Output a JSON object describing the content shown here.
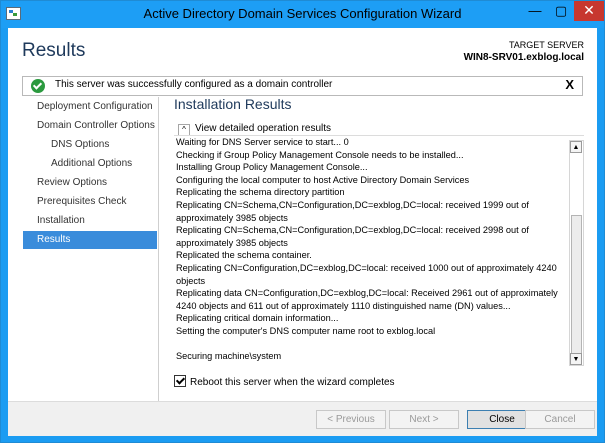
{
  "window": {
    "title": "Active Directory Domain Services Configuration Wizard",
    "minimize_glyph": "—",
    "maximize_glyph": "▢",
    "close_glyph": "✕",
    "accent": "#1d9ef5"
  },
  "header": {
    "title": "Results",
    "target_label": "TARGET SERVER",
    "target_value": "WIN8-SRV01.exblog.local"
  },
  "banner": {
    "message": "This server was successfully configured as a domain controller",
    "close_glyph": "X",
    "icon": "success-check-icon"
  },
  "nav": {
    "items": [
      {
        "label": "Deployment Configuration",
        "sub": false,
        "active": false
      },
      {
        "label": "Domain Controller Options",
        "sub": false,
        "active": false
      },
      {
        "label": "DNS Options",
        "sub": true,
        "active": false
      },
      {
        "label": "Additional Options",
        "sub": true,
        "active": false
      },
      {
        "label": "Review Options",
        "sub": false,
        "active": false
      },
      {
        "label": "Prerequisites Check",
        "sub": false,
        "active": false
      },
      {
        "label": "Installation",
        "sub": false,
        "active": false
      },
      {
        "label": "Results",
        "sub": false,
        "active": true
      }
    ]
  },
  "main": {
    "section_title": "Installation Results",
    "expand_label": "View detailed operation results",
    "expand_glyph": "^",
    "log": [
      "Waiting for DNS Server service to start... 0",
      "Checking if Group Policy Management Console needs to be installed...",
      "Installing Group Policy Management Console...",
      "Configuring the local computer to host Active Directory Domain Services",
      "Replicating the schema directory partition",
      "Replicating CN=Schema,CN=Configuration,DC=exblog,DC=local: received 1999 out of\napproximately 3985 objects",
      "Replicating CN=Schema,CN=Configuration,DC=exblog,DC=local: received 2998 out of\napproximately 3985 objects",
      "Replicated the schema container.",
      "Replicating CN=Configuration,DC=exblog,DC=local: received 1000 out of approximately 4240\nobjects",
      "Replicating data CN=Configuration,DC=exblog,DC=local: Received 2961 out of approximately\n4240 objects and 611 out of approximately 1110 distinguished name (DN) values...",
      "Replicating critical domain information...",
      "Setting the computer's DNS computer name root to exblog.local",
      "",
      "Securing machine\\system"
    ],
    "reboot_label": "Reboot this server when the wizard completes",
    "reboot_checked": true
  },
  "footer": {
    "previous_label": "< Previous",
    "next_label": "Next >",
    "close_label": "Close",
    "cancel_label": "Cancel"
  }
}
